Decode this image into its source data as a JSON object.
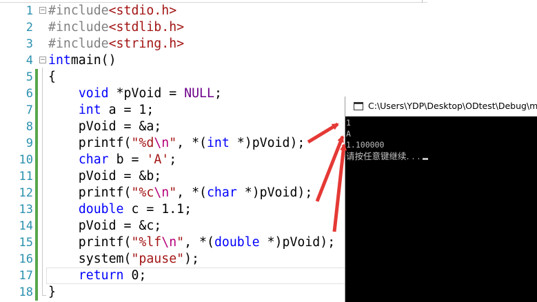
{
  "editor": {
    "lines": [
      {
        "n": "1",
        "tokens": [
          [
            "pp",
            "#include"
          ],
          [
            "inc",
            "<stdio.h>"
          ]
        ]
      },
      {
        "n": "2",
        "tokens": [
          [
            "pp",
            "#include"
          ],
          [
            "inc",
            "<stdlib.h>"
          ]
        ]
      },
      {
        "n": "3",
        "tokens": [
          [
            "pp",
            "#include"
          ],
          [
            "inc",
            "<string.h>"
          ]
        ]
      },
      {
        "n": "4",
        "tokens": [
          [
            "kw",
            "int"
          ],
          [
            "",
            "main()"
          ]
        ]
      },
      {
        "n": "5",
        "tokens": [
          [
            "",
            "{"
          ]
        ]
      },
      {
        "n": "6",
        "tokens": [
          [
            "",
            "    "
          ],
          [
            "kw",
            "void"
          ],
          [
            "",
            " *pVoid = "
          ],
          [
            "macro",
            "NULL"
          ],
          [
            "",
            ";"
          ]
        ]
      },
      {
        "n": "7",
        "tokens": [
          [
            "",
            "    "
          ],
          [
            "kw",
            "int"
          ],
          [
            "",
            " a = 1;"
          ]
        ]
      },
      {
        "n": "8",
        "tokens": [
          [
            "",
            "    pVoid = &a;"
          ]
        ]
      },
      {
        "n": "9",
        "tokens": [
          [
            "",
            "    printf("
          ],
          [
            "str",
            "\"%d"
          ],
          [
            "esc",
            "\\n"
          ],
          [
            "str",
            "\""
          ],
          [
            "",
            ", *("
          ],
          [
            "kw",
            "int"
          ],
          [
            "",
            " *)pVoid);"
          ]
        ]
      },
      {
        "n": "10",
        "tokens": [
          [
            "",
            "    "
          ],
          [
            "kw",
            "char"
          ],
          [
            "",
            " b = "
          ],
          [
            "str",
            "'A'"
          ],
          [
            "",
            ";"
          ]
        ]
      },
      {
        "n": "11",
        "tokens": [
          [
            "",
            "    pVoid = &b;"
          ]
        ]
      },
      {
        "n": "12",
        "tokens": [
          [
            "",
            "    printf("
          ],
          [
            "str",
            "\"%c"
          ],
          [
            "esc",
            "\\n"
          ],
          [
            "str",
            "\""
          ],
          [
            "",
            ", *("
          ],
          [
            "kw",
            "char"
          ],
          [
            "",
            " *)pVoid);"
          ]
        ]
      },
      {
        "n": "13",
        "tokens": [
          [
            "",
            "    "
          ],
          [
            "kw",
            "double"
          ],
          [
            "",
            " c = 1.1;"
          ]
        ]
      },
      {
        "n": "14",
        "tokens": [
          [
            "",
            "    pVoid = &c;"
          ]
        ]
      },
      {
        "n": "15",
        "tokens": [
          [
            "",
            "    printf("
          ],
          [
            "str",
            "\"%lf"
          ],
          [
            "esc",
            "\\n"
          ],
          [
            "str",
            "\""
          ],
          [
            "",
            ", *("
          ],
          [
            "kw",
            "double"
          ],
          [
            "",
            " *)pVoid);"
          ]
        ]
      },
      {
        "n": "16",
        "tokens": [
          [
            "",
            "    system("
          ],
          [
            "str",
            "\"pause\""
          ],
          [
            "",
            ");"
          ]
        ]
      },
      {
        "n": "17",
        "tokens": [
          [
            "",
            "    "
          ],
          [
            "kw",
            "return"
          ],
          [
            "",
            " 0;"
          ]
        ]
      },
      {
        "n": "18",
        "tokens": [
          [
            "",
            "}"
          ]
        ]
      }
    ],
    "fold_markers": [
      "⊟",
      "⊟"
    ]
  },
  "console": {
    "title": "C:\\Users\\YDP\\Desktop\\ODtest\\Debug\\mod",
    "output": [
      "1",
      "A",
      "1.100000",
      "请按任意键继续. . ."
    ]
  },
  "colors": {
    "keyword": "#0000ff",
    "string": "#a31515",
    "line_number": "#2b91af",
    "change_bar": "#57a64a",
    "arrow": "#e53935"
  }
}
